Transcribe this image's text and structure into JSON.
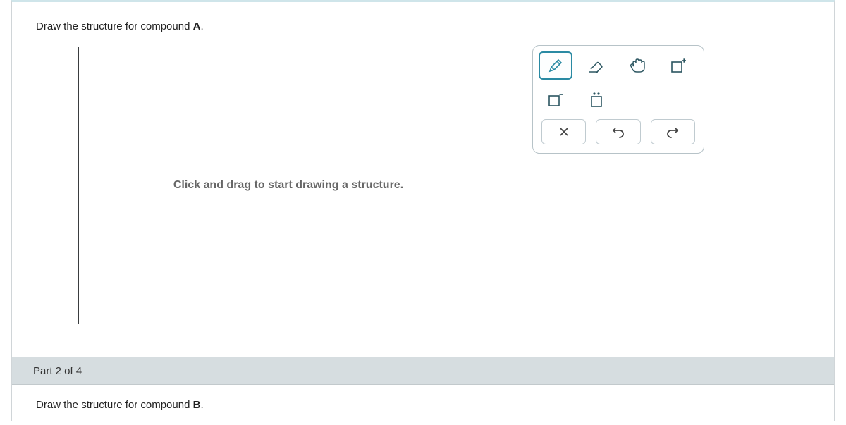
{
  "sectionA": {
    "prompt_prefix": "Draw the structure for compound ",
    "prompt_bold": "A",
    "prompt_suffix": "."
  },
  "canvas": {
    "hint": "Click and drag to start drawing a structure."
  },
  "tools": {
    "pencil": "pencil",
    "eraser": "eraser",
    "move": "move",
    "charge_plus": "charge-plus",
    "charge_minus": "charge-minus",
    "lone_pair": "lone-pair"
  },
  "actions": {
    "clear": "Clear",
    "undo": "Undo",
    "redo": "Redo"
  },
  "partHeader": "Part 2 of 4",
  "sectionB": {
    "prompt_prefix": "Draw the structure for compound ",
    "prompt_bold": "B",
    "prompt_suffix": "."
  }
}
